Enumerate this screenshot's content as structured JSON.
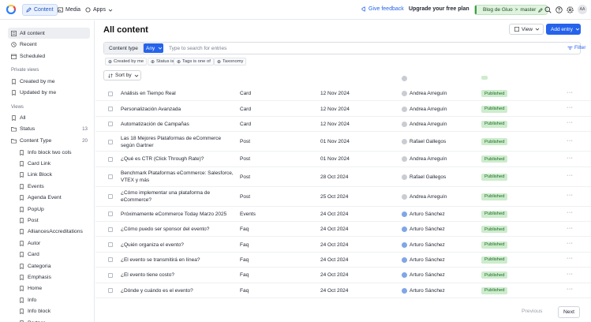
{
  "topbar": {
    "tabs": [
      {
        "label": "Content",
        "icon": "pencil-icon"
      },
      {
        "label": "Media",
        "icon": "image-icon"
      },
      {
        "label": "Apps",
        "icon": "apps-icon"
      }
    ],
    "feedback": "Give feedback",
    "upgrade": "Upgrade your free plan",
    "environment": "Blog de Gluo",
    "branch": "master",
    "avatar_initials": "AA"
  },
  "sidebar": {
    "top_items": [
      "All content",
      "Recent",
      "Scheduled"
    ],
    "private_views_label": "Private views",
    "private_views": [
      "Created by me",
      "Updated by me"
    ],
    "views_label": "Views",
    "views": [
      {
        "label": "All",
        "count": ""
      },
      {
        "label": "Status",
        "count": "13"
      },
      {
        "label": "Content Type",
        "count": "20"
      }
    ],
    "content_types": [
      "Info block two cols",
      "Card Link",
      "Link Block",
      "Events",
      "Agenda Event",
      "PopUp",
      "Post",
      "AlliancesAccreditations",
      "Autor",
      "Card",
      "Categoria",
      "Emphasis",
      "Home",
      "Info",
      "Info block",
      "Partner"
    ]
  },
  "main": {
    "title": "All content",
    "view_label": "View",
    "add_label": "Add entry",
    "filter": {
      "content_type_label": "Content type",
      "any_label": "Any",
      "search_placeholder": "Type to search for entries",
      "filter_link": "Filter"
    },
    "chips": [
      "Created by me",
      "Status is",
      "Tags is one of",
      "Taxonomy"
    ],
    "sort_label": "Sort by",
    "rows": [
      {
        "name": "Análisis en Tiempo Real",
        "type": "Card",
        "date": "12 Nov 2024",
        "author": "Andrea Arreguín",
        "status": "Published"
      },
      {
        "name": "Personalización Avanzada",
        "type": "Card",
        "date": "12 Nov 2024",
        "author": "Andrea Arreguín",
        "status": "Published"
      },
      {
        "name": "Automatización de Campañas",
        "type": "Card",
        "date": "12 Nov 2024",
        "author": "Andrea Arreguín",
        "status": "Published"
      },
      {
        "name": "Las 18 Mejores Plataformas de eCommerce según Gartner",
        "type": "Post",
        "date": "01 Nov 2024",
        "author": "Rafael Gallegos",
        "status": "Published"
      },
      {
        "name": "¿Qué es CTR (Click Through Rate)?",
        "type": "Post",
        "date": "01 Nov 2024",
        "author": "Andrea Arreguín",
        "status": "Published"
      },
      {
        "name": "Benchmark Plataformas eCommerce: Salesforce, VTEX y más",
        "type": "Post",
        "date": "28 Oct 2024",
        "author": "Rafael Gallegos",
        "status": "Published"
      },
      {
        "name": "¿Cómo implementar una plataforma de eCommerce?",
        "type": "Post",
        "date": "25 Oct 2024",
        "author": "Andrea Arreguín",
        "status": "Published"
      },
      {
        "name": "Próximamente eCommerce Today Marzo 2025",
        "type": "Events",
        "date": "24 Oct 2024",
        "author": "Arturo Sánchez",
        "status": "Published"
      },
      {
        "name": "¿Cómo puedo ser sponsor del evento?",
        "type": "Faq",
        "date": "24 Oct 2024",
        "author": "Arturo Sánchez",
        "status": "Published"
      },
      {
        "name": "¿Quién organiza el evento?",
        "type": "Faq",
        "date": "24 Oct 2024",
        "author": "Arturo Sánchez",
        "status": "Published"
      },
      {
        "name": "¿El evento se transmitirá en línea?",
        "type": "Faq",
        "date": "24 Oct 2024",
        "author": "Arturo Sánchez",
        "status": "Published"
      },
      {
        "name": "¿El evento tiene costo?",
        "type": "Faq",
        "date": "24 Oct 2024",
        "author": "Arturo Sánchez",
        "status": "Published"
      },
      {
        "name": "¿Dónde y cuándo es el evento?",
        "type": "Faq",
        "date": "24 Oct 2024",
        "author": "Arturo Sánchez",
        "status": "Published"
      }
    ],
    "row_menu": "···",
    "pager": {
      "previous": "Previous",
      "next": "Next"
    }
  },
  "colors": {
    "accent": "#2563eb",
    "published_bg": "#cdeccd",
    "env_bg": "#dff3df"
  }
}
